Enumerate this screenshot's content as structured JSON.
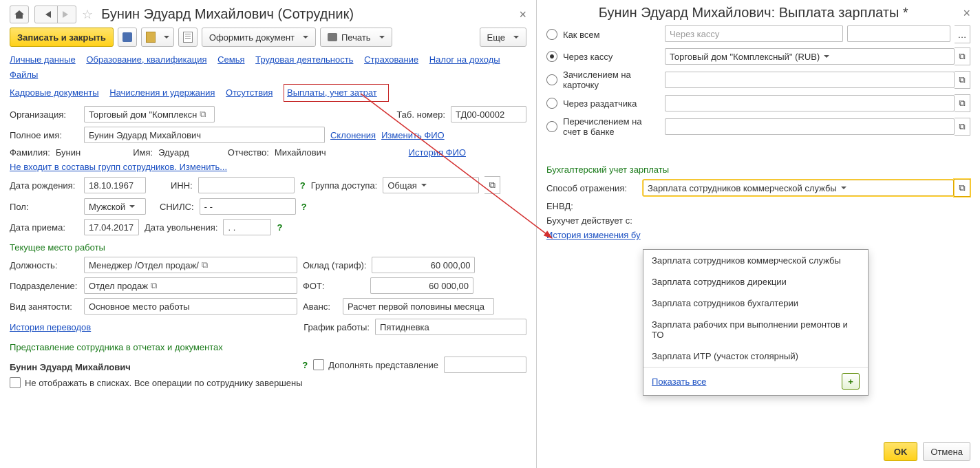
{
  "left": {
    "title": "Бунин Эдуард Михайлович (Сотрудник)",
    "toolbar": {
      "save_close": "Записать и закрыть",
      "doc": "Оформить документ",
      "print": "Печать",
      "more": "Еще"
    },
    "links1": [
      "Личные данные",
      "Образование, квалификация",
      "Семья",
      "Трудовая деятельность",
      "Страхование",
      "Налог на доходы",
      "Файлы"
    ],
    "links2": [
      "Кадровые документы",
      "Начисления и удержания",
      "Отсутствия"
    ],
    "links2_boxed": "Выплаты, учет затрат",
    "org_lbl": "Организация:",
    "org_val": "Торговый дом \"Комплексн",
    "tab_lbl": "Таб. номер:",
    "tab_val": "ТД00-00002",
    "full_lbl": "Полное имя:",
    "full_val": "Бунин Эдуард Михайлович",
    "declension": "Склонения",
    "change_fio": "Изменить ФИО",
    "surname_lbl": "Фамилия:",
    "surname_val": "Бунин",
    "name_lbl": "Имя:",
    "name_val": "Эдуард",
    "patr_lbl": "Отчество:",
    "patr_val": "Михайлович",
    "history_fio": "История ФИО",
    "groups_link": "Не входит в составы групп сотрудников. Изменить...",
    "dob_lbl": "Дата рождения:",
    "dob_val": "18.10.1967",
    "inn_lbl": "ИНН:",
    "access_lbl": "Группа доступа:",
    "access_val": "Общая",
    "sex_lbl": "Пол:",
    "sex_val": "Мужской",
    "snils_lbl": "СНИЛС:",
    "snils_val": "   -   -",
    "hire_lbl": "Дата приема:",
    "hire_val": "17.04.2017",
    "fire_lbl": "Дата увольнения:",
    "fire_val": "  .  .",
    "current_place": "Текущее место работы",
    "pos_lbl": "Должность:",
    "pos_val": "Менеджер /Отдел продаж/",
    "salary_lbl": "Оклад (тариф):",
    "salary_val": "60 000,00",
    "dept_lbl": "Подразделение:",
    "dept_val": "Отдел продаж",
    "fot_lbl": "ФОТ:",
    "fot_val": "60 000,00",
    "emp_lbl": "Вид занятости:",
    "emp_val": "Основное место работы",
    "advance_lbl": "Аванс:",
    "advance_val": "Расчет первой половины месяца",
    "transfer_hist": "История переводов",
    "schedule_lbl": "График работы:",
    "schedule_val": "Пятидневка",
    "report_section": "Представление сотрудника в отчетах и документах",
    "report_name": "Бунин Эдуард Михайлович",
    "supplement_lbl": "Дополнять представление",
    "hide_lbl": "Не отображать в списках. Все операции по сотруднику завершены"
  },
  "right": {
    "title": "Бунин Эдуард Михайлович: Выплата зарплаты *",
    "r1": "Как всем",
    "r1_ph": "Через кассу",
    "r2": "Через кассу",
    "r2_val": "Торговый дом \"Комплексный\" (RUB)",
    "r3": "Зачислением на карточку",
    "r4": "Через раздатчика",
    "r5": "Перечислением на счет в банке",
    "acct_title": "Бухгалтерский учет зарплаты",
    "reflect_lbl": "Способ отражения:",
    "reflect_val": "Зарплата сотрудников коммерческой службы",
    "envd_lbl": "ЕНВД:",
    "valid_lbl": "Бухучет действует с:",
    "history_acct": "История изменения бу",
    "dropdown": [
      "Зарплата сотрудников коммерческой службы",
      "Зарплата сотрудников дирекции",
      "Зарплата сотрудников бухгалтерии",
      "Зарплата рабочих при выполнении ремонтов и ТО",
      "Зарплата ИТР (участок столярный)"
    ],
    "show_all": "Показать все",
    "ok": "OK",
    "cancel": "Отмена"
  }
}
